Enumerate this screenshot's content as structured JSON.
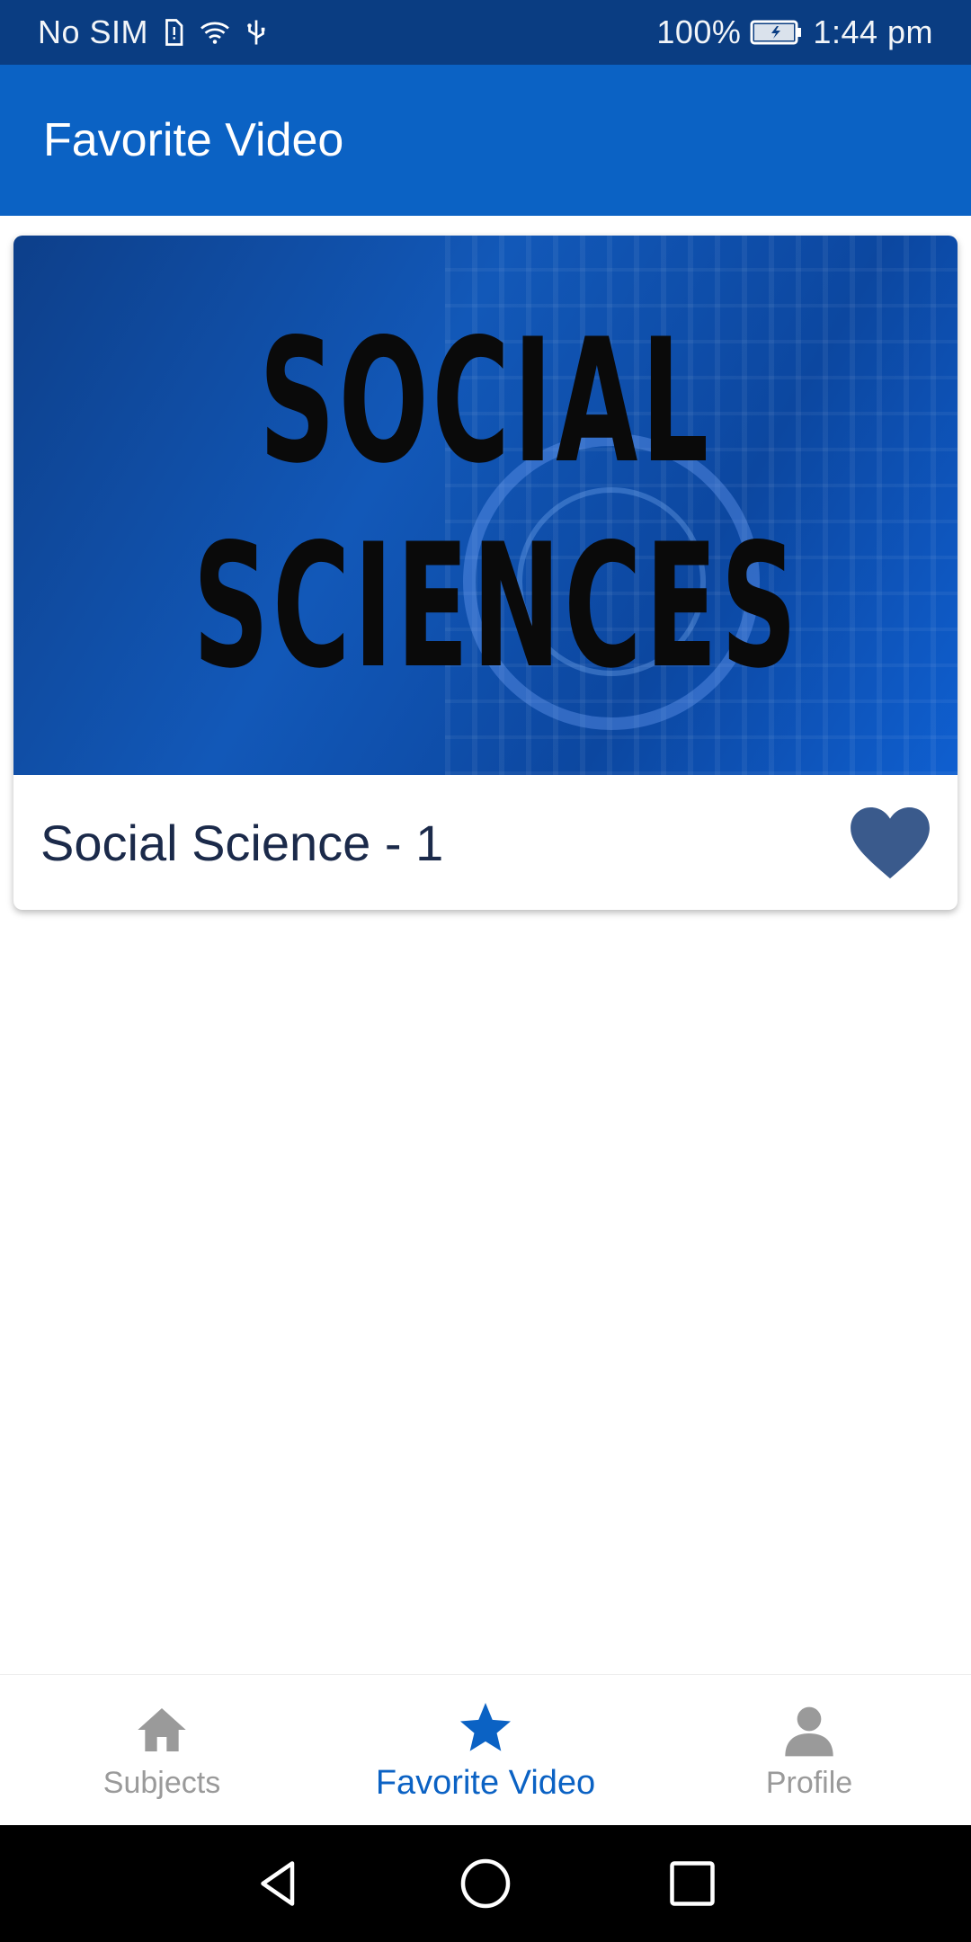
{
  "status_bar": {
    "carrier": "No SIM",
    "battery": "100%",
    "time": "1:44 pm",
    "icons": [
      "sim-alert-icon",
      "wifi-icon",
      "usb-icon",
      "battery-charging-icon"
    ]
  },
  "app_bar": {
    "title": "Favorite Video"
  },
  "videos": [
    {
      "thumbnail_text_line1": "SOCIAL",
      "thumbnail_text_line2": "SCIENCES",
      "title": "Social Science - 1",
      "favorite": true,
      "favorite_icon": "heart-icon"
    }
  ],
  "bottom_nav": {
    "items": [
      {
        "label": "Subjects",
        "icon": "home-icon",
        "active": false
      },
      {
        "label": "Favorite Video",
        "icon": "star-icon",
        "active": true
      },
      {
        "label": "Profile",
        "icon": "person-icon",
        "active": false
      }
    ]
  },
  "system_nav": {
    "icons": [
      "back-icon",
      "home-circle-icon",
      "recents-icon"
    ]
  },
  "colors": {
    "status_bar": "#0a3d82",
    "app_bar": "#0b62c4",
    "heart": "#3a5a8c",
    "nav_active": "#0b62c4",
    "nav_inactive": "#9a9a9a"
  }
}
